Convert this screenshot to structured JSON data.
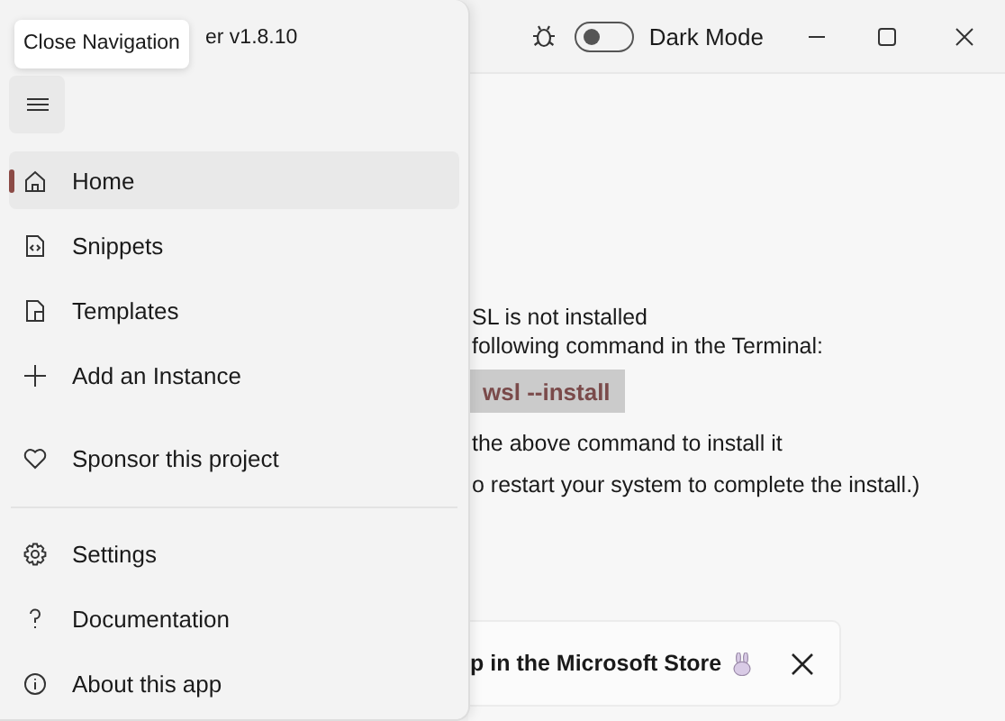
{
  "window": {
    "title": "er v1.8.10",
    "tooltip": "Close Navigation"
  },
  "title_bar": {
    "dark_mode": {
      "label": "Dark Mode",
      "on": false
    }
  },
  "nav": {
    "main": [
      {
        "label": "Home",
        "kind": "home",
        "selected": true
      },
      {
        "label": "Snippets",
        "kind": "snippet",
        "selected": false
      },
      {
        "label": "Templates",
        "kind": "template",
        "selected": false
      },
      {
        "label": "Add an Instance",
        "kind": "add",
        "selected": false
      },
      {
        "label": "Sponsor this project",
        "kind": "heart",
        "selected": false
      }
    ],
    "footer": [
      {
        "label": "Settings",
        "kind": "settings",
        "selected": false
      },
      {
        "label": "Documentation",
        "kind": "help",
        "selected": false
      },
      {
        "label": "About this app",
        "kind": "info",
        "selected": false
      }
    ]
  },
  "content": {
    "lines": [
      "SL is not installed",
      "following command in the Terminal:"
    ],
    "command": "wsl --install",
    "notes": [
      "the above command to install it",
      "o restart your system to complete the install.)"
    ]
  },
  "banner": {
    "text": "p in the Microsoft Store"
  }
}
